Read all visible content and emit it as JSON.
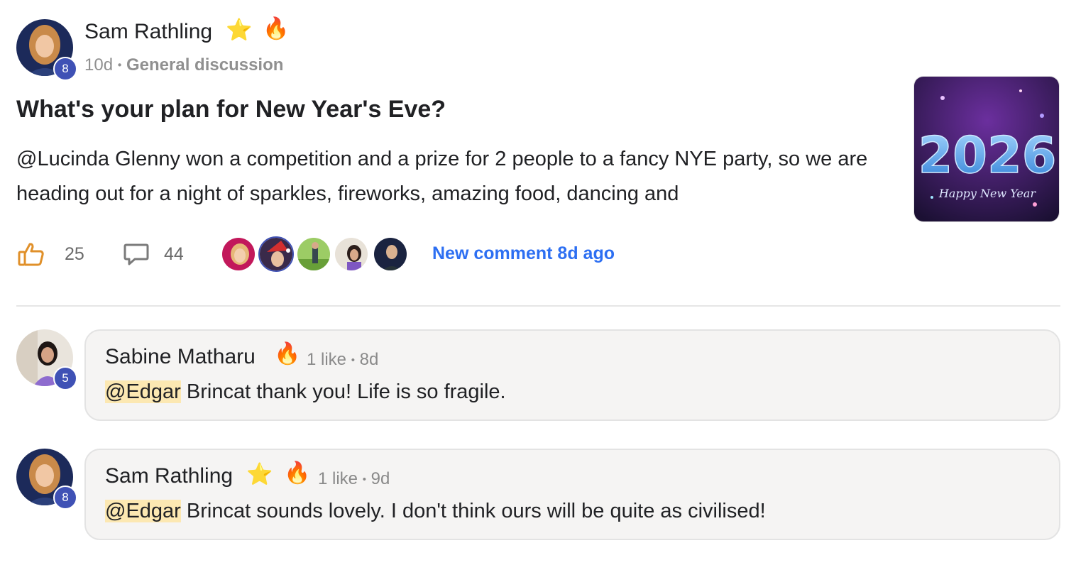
{
  "post": {
    "author": {
      "name": "Sam Rathling",
      "level": "8",
      "badges": [
        "⭐",
        "🔥"
      ]
    },
    "time": "10d",
    "separator": "•",
    "category": "General discussion",
    "title": "What's your plan for New Year's Eve?",
    "body": "@Lucinda Glenny won a competition and a prize for 2 people to a fancy NYE party, so we are heading out for a night of sparkles, fireworks, amazing food, dancing and",
    "thumbnail": {
      "big_text": "2026",
      "caption": "Happy New Year"
    },
    "likes": "25",
    "comments": "44",
    "new_comment_label": "New comment 8d ago"
  },
  "comments": [
    {
      "author": "Sabine Matharu",
      "level": "5",
      "badges": [
        "🔥"
      ],
      "likes_text": "1 like",
      "separator": "•",
      "time": "8d",
      "mention": "@Edgar",
      "text": " Brincat thank you! Life is so fragile."
    },
    {
      "author": "Sam Rathling",
      "level": "8",
      "badges": [
        "⭐",
        "🔥"
      ],
      "likes_text": "1 like",
      "separator": "•",
      "time": "9d",
      "mention": "@Edgar",
      "text": " Brincat sounds lovely. I don't think ours will be quite as civilised!"
    }
  ],
  "colors": {
    "accent_link": "#2d6ff2",
    "level_badge": "#3f51b5",
    "mention_highlight": "#fce8b2",
    "comment_bg": "#f5f4f3"
  },
  "icons": [
    "thumbs-up-icon",
    "comment-bubble-icon"
  ]
}
